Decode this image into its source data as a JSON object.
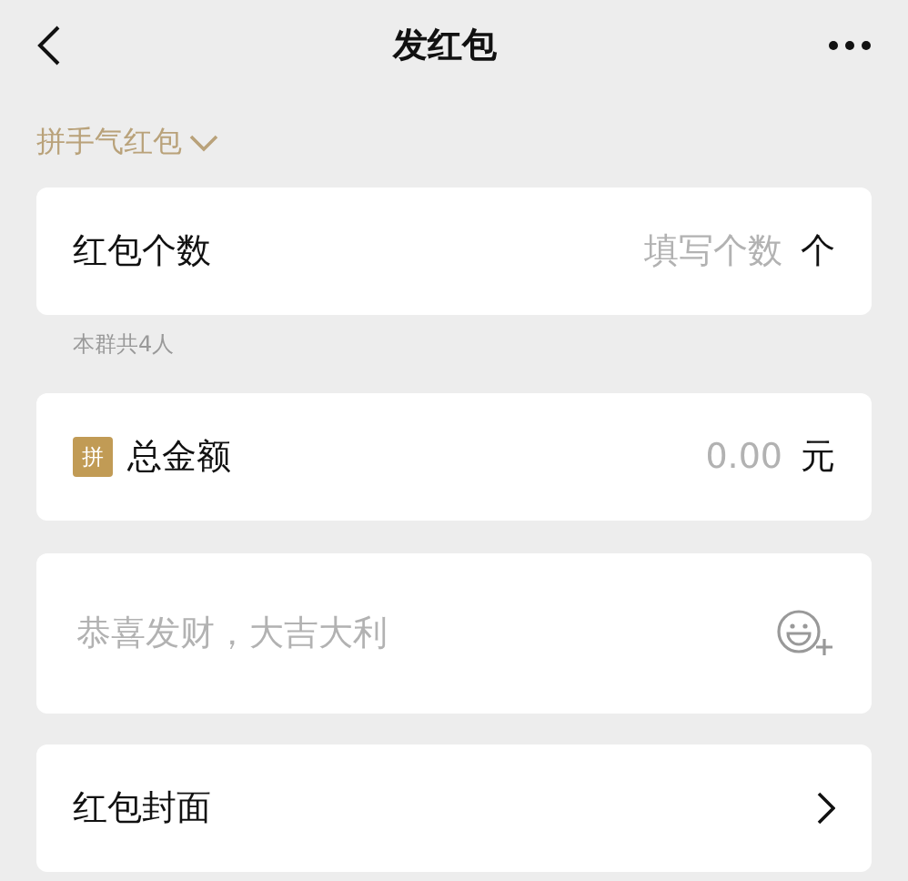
{
  "header": {
    "title": "发红包"
  },
  "type_selector": {
    "label": "拼手气红包"
  },
  "count_card": {
    "label": "红包个数",
    "placeholder": "填写个数",
    "unit": "个"
  },
  "group_note": "本群共4人",
  "amount_card": {
    "badge": "拼",
    "label": "总金额",
    "placeholder": "0.00",
    "unit": "元"
  },
  "greeting_card": {
    "placeholder": "恭喜发财，大吉大利"
  },
  "cover_card": {
    "label": "红包封面"
  }
}
